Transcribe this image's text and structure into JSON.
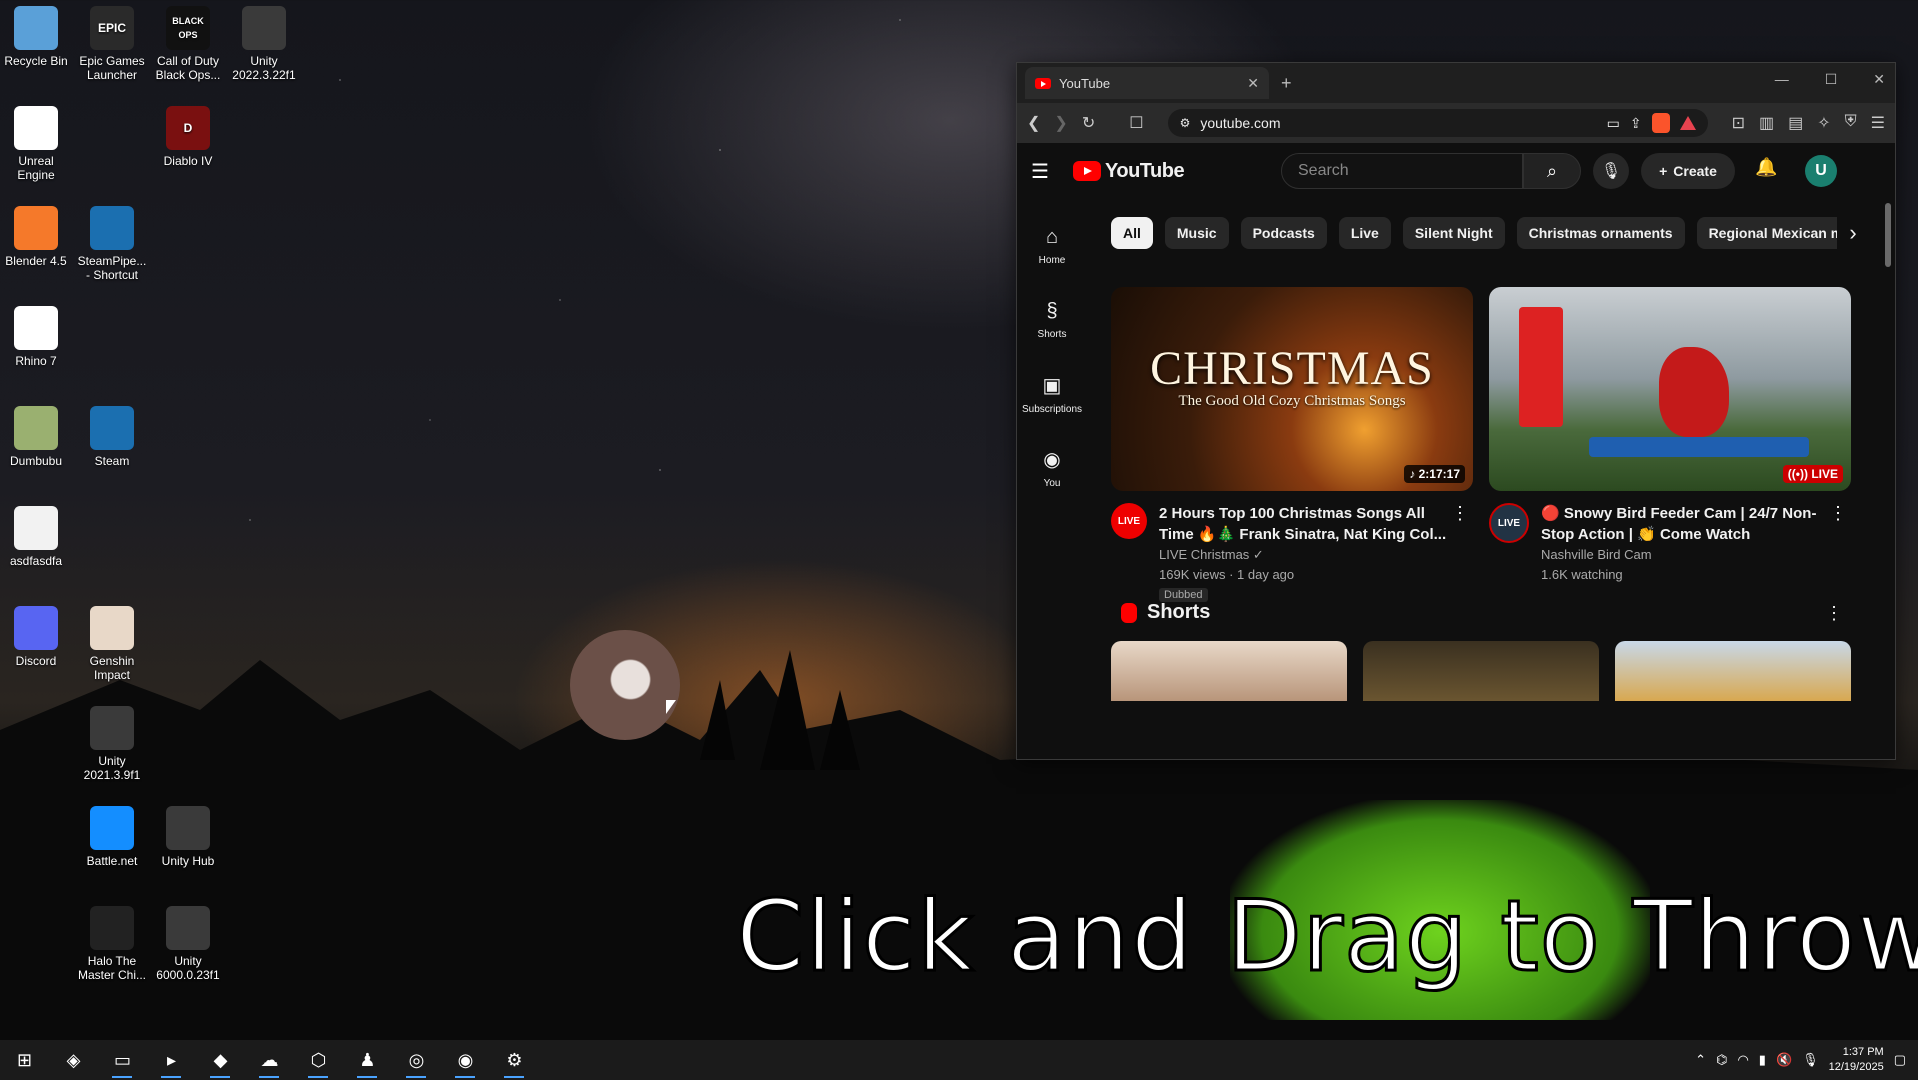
{
  "desktop": {
    "icons": [
      {
        "label": "Recycle Bin",
        "icon": "recycle-bin-icon",
        "color": "#5aa0d8"
      },
      {
        "label": "Epic Games Launcher",
        "icon": "epic-games-icon",
        "color": "#2a2a2a",
        "glyph": "EPIC"
      },
      {
        "label": "Call of Duty Black Ops...",
        "icon": "call-of-duty-icon",
        "color": "#111111",
        "glyph": "BLACK OPS"
      },
      {
        "label": "Unity 2022.3.22f1",
        "icon": "unity-icon",
        "color": "#3a3a3a"
      },
      {
        "label": "Unreal Engine",
        "icon": "unreal-engine-icon",
        "color": "#ffffff"
      },
      {
        "label": "Diablo IV",
        "icon": "diablo-icon",
        "color": "#7a1010",
        "glyph": "D"
      },
      {
        "label": "Blender 4.5",
        "icon": "blender-icon",
        "color": "#f5792a"
      },
      {
        "label": "SteamPipe... - Shortcut",
        "icon": "steam-icon",
        "color": "#1b6fb0"
      },
      {
        "label": "Rhino 7",
        "icon": "rhino-icon",
        "color": "#ffffff"
      },
      {
        "label": "Dumbubu",
        "icon": "dumbubu-icon",
        "color": "#9ab070"
      },
      {
        "label": "Steam",
        "icon": "steam-icon",
        "color": "#1b6fb0"
      },
      {
        "label": "asdfasdfa",
        "icon": "text-file-icon",
        "color": "#f2f2f2"
      },
      {
        "label": "Discord",
        "icon": "discord-icon",
        "color": "#5865f2"
      },
      {
        "label": "Genshin Impact",
        "icon": "genshin-icon",
        "color": "#e8d8c8"
      },
      {
        "label": "Unity 2021.3.9f1",
        "icon": "unity-icon",
        "color": "#3a3a3a"
      },
      {
        "label": "Battle.net",
        "icon": "battlenet-icon",
        "color": "#148eff"
      },
      {
        "label": "Unity Hub",
        "icon": "unity-hub-icon",
        "color": "#3a3a3a"
      },
      {
        "label": "Halo The Master Chi...",
        "icon": "halo-icon",
        "color": "#222222"
      },
      {
        "label": "Unity 6000.0.23f1",
        "icon": "unity-icon",
        "color": "#3a3a3a"
      }
    ],
    "caption": "Click and Drag to Throw"
  },
  "browser": {
    "tab_title": "YouTube",
    "new_tab": "+",
    "url": "youtube.com",
    "window_controls": [
      "—",
      "☐",
      "✕"
    ]
  },
  "youtube": {
    "logo": "YouTube",
    "search_placeholder": "Search",
    "create_label": "Create",
    "avatar_letter": "U",
    "nav": [
      {
        "label": "Home",
        "glyph": "⌂"
      },
      {
        "label": "Shorts",
        "glyph": "§"
      },
      {
        "label": "Subscriptions",
        "glyph": "▣"
      },
      {
        "label": "You",
        "glyph": "◉"
      }
    ],
    "chips": [
      "All",
      "Music",
      "Podcasts",
      "Live",
      "Silent Night",
      "Christmas ornaments",
      "Regional Mexican musi"
    ],
    "videos": [
      {
        "thumb_title": "CHRISTMAS",
        "thumb_subtitle": "The Good Old Cozy Christmas Songs",
        "duration": "♪ 2:17:17",
        "channel_badge": "LIVE",
        "title": "2 Hours Top 100 Christmas Songs All Time 🔥🎄 Frank Sinatra, Nat King Col...",
        "channel": "LIVE Christmas ✓",
        "stats": "169K views · 1 day ago",
        "tag": "Dubbed"
      },
      {
        "duration": "((•)) LIVE",
        "channel_badge": "LIVE",
        "title": "🔴 Snowy Bird Feeder Cam | 24/7 Non-Stop Action | 👏 Come Watch",
        "channel": "Nashville Bird Cam",
        "stats": "1.6K watching"
      }
    ],
    "shorts_label": "Shorts"
  },
  "taskbar": {
    "items": [
      {
        "name": "start-button",
        "glyph": "⊞"
      },
      {
        "name": "copilot-icon",
        "glyph": "◈"
      },
      {
        "name": "file-explorer-icon",
        "glyph": "▭"
      },
      {
        "name": "terminal-icon",
        "glyph": "▸"
      },
      {
        "name": "brave-browser-icon",
        "glyph": "◆"
      },
      {
        "name": "weather-app-icon",
        "glyph": "☁"
      },
      {
        "name": "unity-icon",
        "glyph": "⬡"
      },
      {
        "name": "game-app-icon",
        "glyph": "♟"
      },
      {
        "name": "steam-icon",
        "glyph": "◎"
      },
      {
        "name": "obs-icon",
        "glyph": "◉"
      },
      {
        "name": "settings-icon",
        "glyph": "⚙"
      }
    ],
    "time": "1:37 PM",
    "date": "12/19/2025"
  }
}
